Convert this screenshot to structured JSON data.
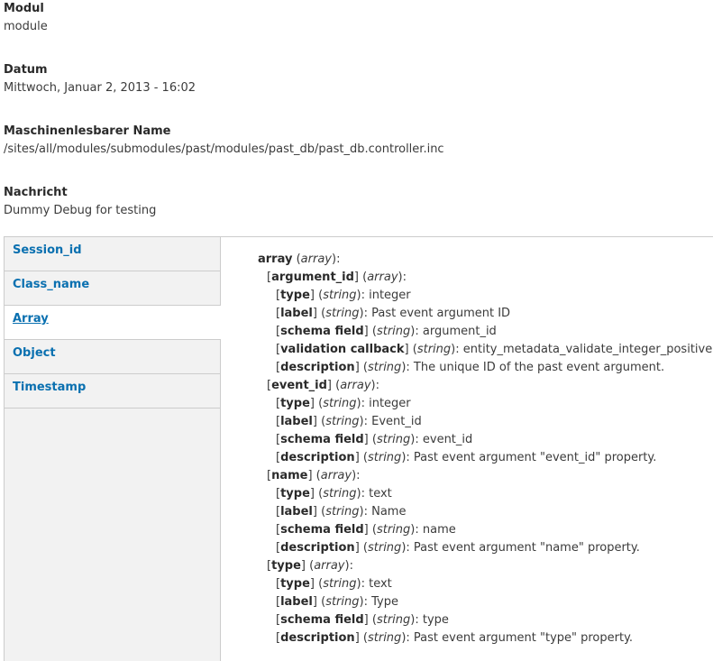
{
  "fields": [
    {
      "label": "Modul",
      "value": "module"
    },
    {
      "label": "Datum",
      "value": "Mittwoch, Januar 2, 2013 - 16:02"
    },
    {
      "label": "Maschinenlesbarer Name",
      "value": "/sites/all/modules/submodules/past/modules/past_db/past_db.controller.inc"
    },
    {
      "label": "Nachricht",
      "value": "Dummy Debug for testing"
    }
  ],
  "tabs": [
    {
      "label": "Session_id"
    },
    {
      "label": "Class_name"
    },
    {
      "label": "Array",
      "selected": true
    },
    {
      "label": "Object"
    },
    {
      "label": "Timestamp"
    }
  ],
  "tree": [
    {
      "level": 0,
      "key": "array",
      "type": "array",
      "value": "",
      "bracket": false
    },
    {
      "level": 1,
      "key": "argument_id",
      "type": "array",
      "value": ""
    },
    {
      "level": 2,
      "key": "type",
      "type": "string",
      "value": "integer"
    },
    {
      "level": 2,
      "key": "label",
      "type": "string",
      "value": "Past event argument ID"
    },
    {
      "level": 2,
      "key": "schema field",
      "type": "string",
      "value": "argument_id"
    },
    {
      "level": 2,
      "key": "validation callback",
      "type": "string",
      "value": "entity_metadata_validate_integer_positive"
    },
    {
      "level": 2,
      "key": "description",
      "type": "string",
      "value": "The unique ID of the past event argument."
    },
    {
      "level": 1,
      "key": "event_id",
      "type": "array",
      "value": ""
    },
    {
      "level": 2,
      "key": "type",
      "type": "string",
      "value": "integer"
    },
    {
      "level": 2,
      "key": "label",
      "type": "string",
      "value": "Event_id"
    },
    {
      "level": 2,
      "key": "schema field",
      "type": "string",
      "value": "event_id"
    },
    {
      "level": 2,
      "key": "description",
      "type": "string",
      "value": "Past event argument \"event_id\" property."
    },
    {
      "level": 1,
      "key": "name",
      "type": "array",
      "value": ""
    },
    {
      "level": 2,
      "key": "type",
      "type": "string",
      "value": "text"
    },
    {
      "level": 2,
      "key": "label",
      "type": "string",
      "value": "Name"
    },
    {
      "level": 2,
      "key": "schema field",
      "type": "string",
      "value": "name"
    },
    {
      "level": 2,
      "key": "description",
      "type": "string",
      "value": "Past event argument \"name\" property."
    },
    {
      "level": 1,
      "key": "type",
      "type": "array",
      "value": ""
    },
    {
      "level": 2,
      "key": "type",
      "type": "string",
      "value": "text"
    },
    {
      "level": 2,
      "key": "label",
      "type": "string",
      "value": "Type"
    },
    {
      "level": 2,
      "key": "schema field",
      "type": "string",
      "value": "type"
    },
    {
      "level": 2,
      "key": "description",
      "type": "string",
      "value": "Past event argument \"type\" property."
    }
  ]
}
